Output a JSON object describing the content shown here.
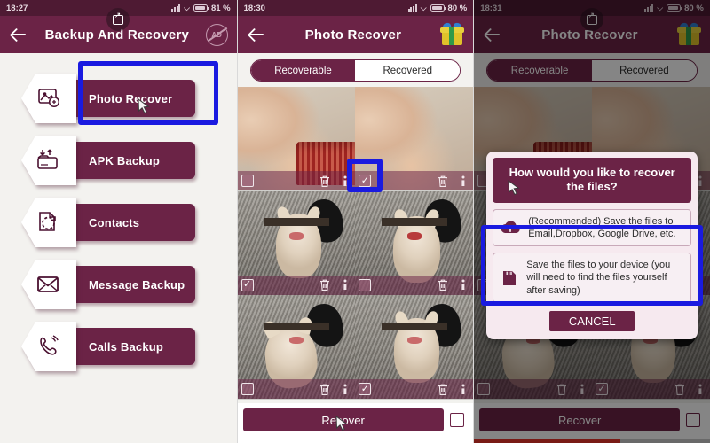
{
  "panels": [
    {
      "status": {
        "time": "18:27",
        "battery": "81 %",
        "signal_icon": "signal-bars-icon",
        "wifi_icon": "wifi-icon",
        "battery_icon": "battery-icon"
      },
      "appbar": {
        "title": "Backup And Recovery",
        "back_icon": "back-arrow-icon",
        "right_icon": "no-ads-icon",
        "badge_icon": "screencast-icon"
      },
      "menu": [
        {
          "label": "Photo Recover",
          "icon": "photo-recover-icon",
          "highlighted": true
        },
        {
          "label": "APK Backup",
          "icon": "apk-backup-icon",
          "highlighted": false
        },
        {
          "label": "Contacts",
          "icon": "contacts-icon",
          "highlighted": false
        },
        {
          "label": "Message Backup",
          "icon": "message-backup-icon",
          "highlighted": false
        },
        {
          "label": "Calls Backup",
          "icon": "calls-backup-icon",
          "highlighted": false
        }
      ]
    },
    {
      "status": {
        "time": "18:30",
        "battery": "80 %"
      },
      "appbar": {
        "title": "Photo Recover",
        "back_icon": "back-arrow-icon",
        "right_icon": "gift-icon"
      },
      "tabs": [
        {
          "label": "Recoverable",
          "active": true
        },
        {
          "label": "Recovered",
          "active": false
        }
      ],
      "grid": [
        {
          "name": "photo-thumb-1",
          "checked": false,
          "trash_icon": "trash-icon",
          "info_icon": "info-icon"
        },
        {
          "name": "photo-thumb-2",
          "checked": true,
          "trash_icon": "trash-icon",
          "info_icon": "info-icon"
        },
        {
          "name": "photo-thumb-3",
          "checked": true,
          "trash_icon": "trash-icon",
          "info_icon": "info-icon"
        },
        {
          "name": "photo-thumb-4",
          "checked": false,
          "trash_icon": "trash-icon",
          "info_icon": "info-icon"
        },
        {
          "name": "photo-thumb-5",
          "checked": false,
          "trash_icon": "trash-icon",
          "info_icon": "info-icon"
        },
        {
          "name": "photo-thumb-6",
          "checked": true,
          "trash_icon": "trash-icon",
          "info_icon": "info-icon"
        }
      ],
      "bottom": {
        "recover_label": "Recover",
        "select_all_checked": false
      }
    },
    {
      "status": {
        "time": "18:31",
        "battery": "80 %"
      },
      "appbar": {
        "title": "Photo Recover",
        "back_icon": "back-arrow-icon",
        "right_icon": "gift-icon",
        "badge_icon": "screencast-icon"
      },
      "tabs": [
        {
          "label": "Recoverable",
          "active": true
        },
        {
          "label": "Recovered",
          "active": false
        }
      ],
      "dialog": {
        "title": "How would you like to recover the files?",
        "options": [
          {
            "text": "(Recommended) Save the files to Email,Dropbox, Google Drive, etc.",
            "icon": "cloud-upload-icon"
          },
          {
            "text": "Save the files to your device (you will need to find the files yourself after saving)",
            "icon": "sd-card-icon",
            "highlighted": true
          }
        ],
        "cancel_label": "CANCEL"
      },
      "bottom": {
        "recover_label": "Recover",
        "select_all_checked": false
      },
      "progress_percent": 62
    }
  ],
  "colors": {
    "brand_purple": "#6b2346",
    "statusbar_purple": "#4e1a33",
    "highlight_blue": "#1a1ae0",
    "progress_red": "#e8352b",
    "dialog_bg": "#f6e9ef"
  }
}
